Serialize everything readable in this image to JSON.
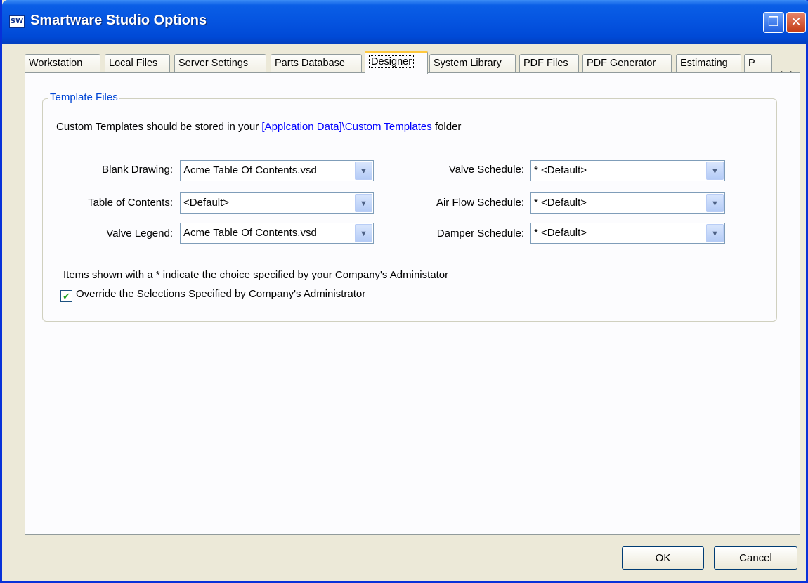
{
  "window": {
    "title": "Smartware Studio Options",
    "icon_text": "SW",
    "restore_glyph": "❐",
    "close_glyph": "✕"
  },
  "tabs": [
    {
      "label": "Workstation"
    },
    {
      "label": "Local Files"
    },
    {
      "label": "Server Settings"
    },
    {
      "label": "Parts Database"
    },
    {
      "label": "Designer",
      "active": true
    },
    {
      "label": "System Library"
    },
    {
      "label": "PDF Files"
    },
    {
      "label": "PDF Generator"
    },
    {
      "label": "Estimating"
    },
    {
      "label": "P"
    }
  ],
  "tab_scroll": {
    "left": "◀",
    "right": "▶"
  },
  "group": {
    "title": "Template Files",
    "desc_prefix": "Custom Templates should be stored in your ",
    "desc_link": "[Applcation Data]\\Custom Templates",
    "desc_suffix": " folder"
  },
  "fields": {
    "blank_drawing": {
      "label": "Blank Drawing:",
      "value": "Acme Table Of Contents.vsd"
    },
    "table_of_contents": {
      "label": "Table of Contents:",
      "value": "<Default>"
    },
    "valve_legend": {
      "label": "Valve Legend:",
      "value": "Acme Table Of Contents.vsd"
    },
    "valve_schedule": {
      "label": "Valve Schedule:",
      "value": "* <Default>"
    },
    "air_flow_schedule": {
      "label": "Air Flow Schedule:",
      "value": "* <Default>"
    },
    "damper_schedule": {
      "label": "Damper Schedule:",
      "value": "* <Default>"
    }
  },
  "note": "Items shown with a * indicate the choice specified by your Company's Administator",
  "override": {
    "label": "Override the Selections Specified by Company's Administrator",
    "checked": true,
    "check_glyph": "✔"
  },
  "buttons": {
    "ok": "OK",
    "cancel": "Cancel"
  },
  "dropdown_glyph": "▼"
}
